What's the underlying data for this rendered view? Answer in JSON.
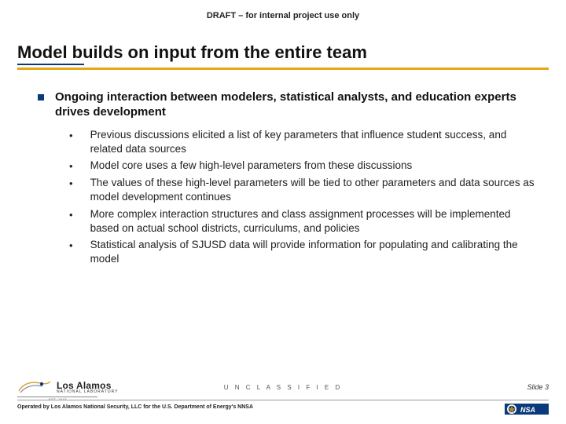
{
  "header": {
    "draft": "DRAFT – for internal project use only"
  },
  "title": "Model builds on input from the entire team",
  "main_point": "Ongoing interaction between modelers, statistical analysts, and education experts drives development",
  "sub_points": [
    "Previous discussions elicited a list of key parameters that influence student success, and related data sources",
    "Model core uses a few high-level parameters from these discussions",
    "The values of these high-level parameters will be tied to other parameters and data sources as model development continues",
    "More complex interaction structures and class assignment processes will be implemented based on actual school districts, curriculums, and policies",
    "Statistical analysis of SJUSD data will provide information for populating and calibrating the model"
  ],
  "footer": {
    "logo_main": "Los Alamos",
    "logo_sub": "NATIONAL LABORATORY",
    "est": "EST. 1943",
    "classification": "U N C L A S S I F I E D",
    "slide": "Slide 3",
    "operated": "Operated by Los Alamos National Security, LLC for the U.S. Department of Energy's NNSA"
  }
}
